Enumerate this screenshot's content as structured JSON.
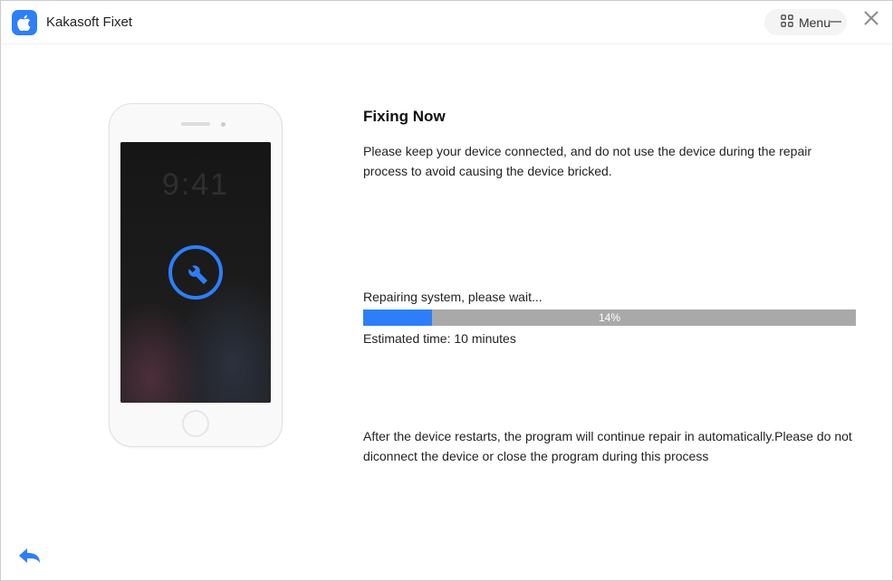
{
  "app": {
    "title": "Kakasoft Fixet",
    "menu_label": "Menu"
  },
  "main": {
    "heading": "Fixing Now",
    "description": "Please keep your device connected, and do not use the device during the repair process to avoid causing the device bricked.",
    "status_label": "Repairing system, please wait...",
    "progress_percent": 14,
    "progress_text": "14%",
    "eta_label": "Estimated time: 10 minutes",
    "footnote": "After the device restarts, the program will continue repair in automatically.Please do not diconnect the device or close the program during this process"
  },
  "phone": {
    "lock_time": "9:41"
  },
  "colors": {
    "accent": "#2d7ff9",
    "progress_bg": "#a9a9a9"
  }
}
